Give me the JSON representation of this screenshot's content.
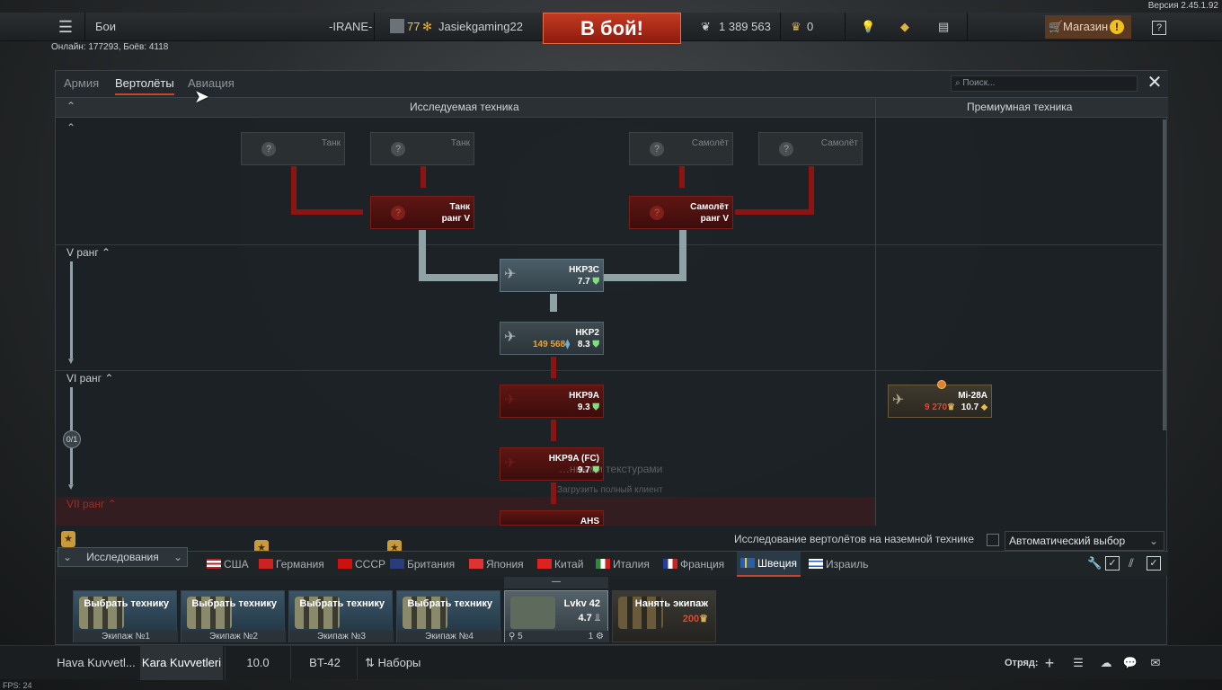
{
  "version": "Версия 2.45.1.92",
  "topbar": {
    "mode": "Бои",
    "squadron": "-IRANE-",
    "level": "77",
    "username": "Jasiekgaming22",
    "battle_button": "В бой!",
    "silver": "1 389 563",
    "gold": "0",
    "shop": "Магазин",
    "help": "?"
  },
  "online": "Онлайн: 177293, Боёв: 4118",
  "tabs": [
    {
      "label": "Армия"
    },
    {
      "label": "Вертолёты"
    },
    {
      "label": "Авиация"
    }
  ],
  "search": {
    "placeholder": "Поиск..."
  },
  "sections": {
    "researched": "Исследуемая техника",
    "premium": "Премиумная техника"
  },
  "ranks": {
    "r5": "V ранг",
    "r6": "VI ранг",
    "r7": "VII ранг",
    "r6_progress": "0/1"
  },
  "locked": [
    {
      "type": "Танк"
    },
    {
      "type": "Танк"
    },
    {
      "type": "Самолёт"
    },
    {
      "type": "Самолёт"
    }
  ],
  "requirements": [
    {
      "line1": "Танк",
      "line2": "ранг V"
    },
    {
      "line1": "Самолёт",
      "line2": "ранг V"
    }
  ],
  "vehicles": [
    {
      "name": "HKP3C",
      "br": "7.7",
      "cost": ""
    },
    {
      "name": "HKP2",
      "br": "8.3",
      "cost": "149 568"
    },
    {
      "name": "HKP9A",
      "br": "9.3",
      "cost": ""
    },
    {
      "name": "HKP9A (FC)",
      "br": "9.7",
      "cost": ""
    },
    {
      "name": "AHS",
      "br": "",
      "cost": ""
    }
  ],
  "premium_vehicle": {
    "name": "Mi-28A",
    "br": "10.7",
    "cost": "9 270"
  },
  "overlay": {
    "text1": "…нными текстурами",
    "text2": "Загрузить полный клиент"
  },
  "options": {
    "ground_research": "Исследование вертолётов на наземной технике",
    "auto_select": "Автоматический выбор"
  },
  "research_tab": "Исследования",
  "countries": [
    {
      "name": "США",
      "active": false
    },
    {
      "name": "Германия",
      "active": false
    },
    {
      "name": "СССР",
      "active": false
    },
    {
      "name": "Британия",
      "active": false
    },
    {
      "name": "Япония",
      "active": false
    },
    {
      "name": "Китай",
      "active": false
    },
    {
      "name": "Италия",
      "active": false
    },
    {
      "name": "Франция",
      "active": false
    },
    {
      "name": "Швеция",
      "active": true
    },
    {
      "name": "Израиль",
      "active": false
    }
  ],
  "crew": [
    {
      "label": "Выбрать технику",
      "slot": "Экипаж №1"
    },
    {
      "label": "Выбрать технику",
      "slot": "Экипаж №2"
    },
    {
      "label": "Выбрать технику",
      "slot": "Экипаж №3"
    },
    {
      "label": "Выбрать технику",
      "slot": "Экипаж №4"
    }
  ],
  "crew_vehicle": {
    "name": "Lvkv 42",
    "br": "4.7",
    "top": "—",
    "left_stat": "5",
    "right_stat": "1"
  },
  "hire_crew": {
    "label": "Нанять экипаж",
    "cost": "200"
  },
  "bottombar": {
    "preset1": "Hava Kuvvetl...",
    "preset2": "Kara Kuvvetleri",
    "br": "10.0",
    "bt": "BT-42",
    "sets": "Наборы",
    "squad": "Отряд:"
  },
  "fps": "FPS: 24"
}
